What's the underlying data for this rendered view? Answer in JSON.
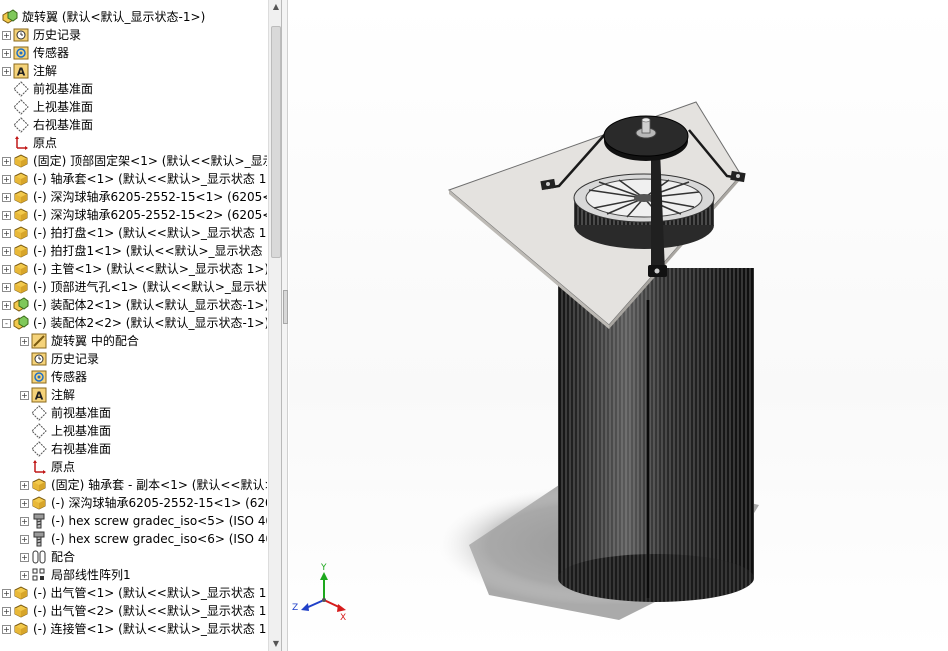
{
  "tree": {
    "root": "旋转翼 (默认<默认_显示状态-1>)",
    "items": [
      {
        "label": "历史记录",
        "icon": "history-icon"
      },
      {
        "label": "传感器",
        "icon": "sensor-icon"
      },
      {
        "label": "注解",
        "icon": "annotation-icon"
      },
      {
        "label": "前视基准面",
        "icon": "plane-icon"
      },
      {
        "label": "上视基准面",
        "icon": "plane-icon"
      },
      {
        "label": "右视基准面",
        "icon": "plane-icon"
      },
      {
        "label": "原点",
        "icon": "origin-icon"
      },
      {
        "label": "(固定) 顶部固定架<1> (默认<<默认>_显示",
        "icon": "part-icon"
      },
      {
        "label": "(-) 轴承套<1> (默认<<默认>_显示状态 1>",
        "icon": "part-icon"
      },
      {
        "label": "(-) 深沟球轴承6205-2552-15<1> (6205<<",
        "icon": "part-icon"
      },
      {
        "label": "(-) 深沟球轴承6205-2552-15<2> (6205<<",
        "icon": "part-icon"
      },
      {
        "label": "(-) 拍打盘<1> (默认<<默认>_显示状态 1>",
        "icon": "part-icon"
      },
      {
        "label": "(-) 拍打盘1<1> (默认<<默认>_显示状态 1",
        "icon": "part-icon"
      },
      {
        "label": "(-) 主管<1> (默认<<默认>_显示状态 1>)",
        "icon": "part-icon"
      },
      {
        "label": "(-) 顶部进气孔<1> (默认<<默认>_显示状态",
        "icon": "part-icon"
      },
      {
        "label": "(-) 装配体2<1> (默认<默认_显示状态-1>)",
        "icon": "assembly-icon"
      },
      {
        "label": "(-) 装配体2<2> (默认<默认_显示状态-1>)",
        "icon": "assembly-icon"
      },
      {
        "label": "旋转翼 中的配合",
        "icon": "mate-folder-icon"
      },
      {
        "label": "历史记录",
        "icon": "history-icon"
      },
      {
        "label": "传感器",
        "icon": "sensor-icon"
      },
      {
        "label": "注解",
        "icon": "annotation-icon"
      },
      {
        "label": "前视基准面",
        "icon": "plane-icon"
      },
      {
        "label": "上视基准面",
        "icon": "plane-icon"
      },
      {
        "label": "右视基准面",
        "icon": "plane-icon"
      },
      {
        "label": "原点",
        "icon": "origin-icon"
      },
      {
        "label": "(固定) 轴承套 - 副本<1> (默认<<默认>",
        "icon": "part-icon"
      },
      {
        "label": "(-) 深沟球轴承6205-2552-15<1> (6205",
        "icon": "part-icon"
      },
      {
        "label": "(-) hex screw gradec_iso<5> (ISO 40",
        "icon": "screw-icon"
      },
      {
        "label": "(-) hex screw gradec_iso<6> (ISO 40",
        "icon": "screw-icon"
      },
      {
        "label": "配合",
        "icon": "mates-icon"
      },
      {
        "label": "局部线性阵列1",
        "icon": "pattern-icon"
      },
      {
        "label": "(-) 出气管<1> (默认<<默认>_显示状态 1>",
        "icon": "part-icon"
      },
      {
        "label": "(-) 出气管<2> (默认<<默认>_显示状态 1>",
        "icon": "part-icon"
      },
      {
        "label": "(-) 连接管<1> (默认<<默认>_显示状态 1>",
        "icon": "part-icon"
      }
    ]
  },
  "triad": {
    "x": "X",
    "y": "Y",
    "z": "Z"
  },
  "colors": {
    "plate": "#e4e2df",
    "cylinder": "#262626",
    "triad_x": "#d61c1c",
    "triad_y": "#1da81d",
    "triad_z": "#2040c8"
  }
}
